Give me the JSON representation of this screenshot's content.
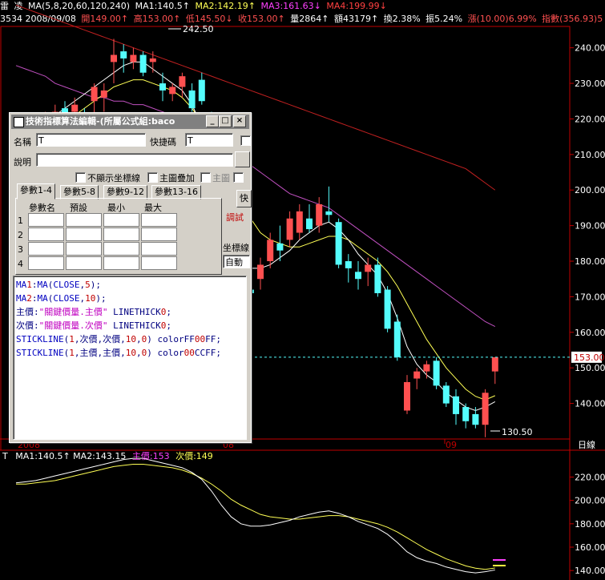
{
  "header": {
    "name_part1": "雷",
    "name_part2": "凌",
    "ma_params": "MA(5,8,20,60,120,240)",
    "ma1": "MA1:140.5↑",
    "ma2": "MA2:142.19↑",
    "ma3": "MA3:161.63↓",
    "ma4": "MA4:199.99↓",
    "code_date": "3534 2008/09/08",
    "open": "開149.00↑",
    "high": "高153.00↑",
    "low": "低145.50↓",
    "close": "收153.00↑",
    "volume": "量2864↑",
    "amount": "額43179↑",
    "turnover": "換2.38%",
    "amplitude": "振5.24%",
    "change": "漲(10.00)6.99%",
    "index": "指數(356.93)5"
  },
  "colors": {
    "background": "#000000",
    "up_candle": "#ff5050",
    "down_candle": "#54fcfc",
    "ma1": "#ffffff",
    "ma2": "#ffff55",
    "ma3": "#c050c0",
    "ma4": "#c02020",
    "frame": "#c00000",
    "accent_magenta": "#ff40ff",
    "accent_yellow": "#ffff40"
  },
  "price_axis": {
    "ticks": [
      "240.00",
      "230.00",
      "220.00",
      "210.00",
      "200.00",
      "190.00",
      "180.00",
      "170.00",
      "160.00",
      "150.00",
      "140.00"
    ],
    "current_price": "153.00",
    "high_marker": "242.50",
    "low_marker": "130.50"
  },
  "time_axis": {
    "labels": [
      "2008",
      "08",
      "09"
    ],
    "corner": "日線"
  },
  "indicator_panel": {
    "name": "T",
    "ma1": "MA1:140.5↑",
    "ma2": "MA2:143.15",
    "main_price": "主價:153",
    "sub_price": "次價:149",
    "ticks": [
      "220.00",
      "200.00",
      "180.00",
      "160.00",
      "140.00"
    ]
  },
  "dialog": {
    "title": "技術指標算法編輯-(所屬公式組:baco",
    "min_label": "_",
    "max_label": "□",
    "close_label": "×",
    "name_label": "名稱",
    "name_value": "T",
    "hotkey_label": "快捷碼",
    "hotkey_value": "T",
    "desc_label": "說明",
    "desc_value": "",
    "chk_no_axis": "不顯示坐標線",
    "chk_main_overlay": "主圖疊加",
    "chk_main_graph": "主圖",
    "tabs": [
      "參數1-4",
      "參數5-8",
      "參數9-12",
      "參數13-16"
    ],
    "param_headers": [
      "參數名",
      "預設",
      "最小",
      "最大"
    ],
    "row_labels": [
      "1",
      "2",
      "3",
      "4"
    ],
    "side_button": "快",
    "debug_label": "調試",
    "axis_label": "坐標線",
    "axis_value": "自動",
    "code_lines": [
      "MA1:MA(CLOSE,5);",
      "MA2:MA(CLOSE,10);",
      "主價:\"關鍵價量.主價\" LINETHICK0;",
      "次價:\"關鍵價量.次價\" LINETHICK0;",
      "STICKLINE(1,次價,次價,10,0) colorFF00FF;",
      "STICKLINE(1,主價,主價,10,0) color00CCFF;"
    ]
  },
  "chart_data": {
    "type": "candlestick",
    "ylim": [
      130,
      246
    ],
    "candles": [
      {
        "o": 215,
        "h": 218,
        "l": 212,
        "c": 213
      },
      {
        "o": 213,
        "h": 219,
        "l": 211,
        "c": 217
      },
      {
        "o": 214,
        "h": 218,
        "l": 212,
        "c": 216
      },
      {
        "o": 218,
        "h": 222,
        "l": 216,
        "c": 220
      },
      {
        "o": 219,
        "h": 224,
        "l": 217,
        "c": 222
      },
      {
        "o": 223,
        "h": 225,
        "l": 218,
        "c": 219
      },
      {
        "o": 222,
        "h": 226,
        "l": 220,
        "c": 224
      },
      {
        "o": 221,
        "h": 223,
        "l": 218,
        "c": 219
      },
      {
        "o": 225,
        "h": 230,
        "l": 220,
        "c": 229
      },
      {
        "o": 226,
        "h": 230,
        "l": 222,
        "c": 228
      },
      {
        "o": 236,
        "h": 242.5,
        "l": 230,
        "c": 238
      },
      {
        "o": 239,
        "h": 241,
        "l": 233,
        "c": 237
      },
      {
        "o": 236,
        "h": 240,
        "l": 234,
        "c": 238
      },
      {
        "o": 238,
        "h": 239,
        "l": 232,
        "c": 233
      },
      {
        "o": 236,
        "h": 239,
        "l": 233,
        "c": 237
      },
      {
        "o": 230,
        "h": 233,
        "l": 225,
        "c": 228
      },
      {
        "o": 227,
        "h": 230,
        "l": 225,
        "c": 229
      },
      {
        "o": 229,
        "h": 233,
        "l": 226,
        "c": 232
      },
      {
        "o": 228,
        "h": 230,
        "l": 222,
        "c": 223
      },
      {
        "o": 231,
        "h": 233,
        "l": 224,
        "c": 225
      },
      {
        "o": 220,
        "h": 222,
        "l": 210,
        "c": 212
      },
      {
        "o": 185,
        "h": 190,
        "l": 180,
        "c": 183
      },
      {
        "o": 176,
        "h": 180,
        "l": 165,
        "c": 168
      },
      {
        "o": 170,
        "h": 178,
        "l": 163,
        "c": 176
      },
      {
        "o": 172,
        "h": 180,
        "l": 168,
        "c": 171
      },
      {
        "o": 175,
        "h": 181,
        "l": 172,
        "c": 179
      },
      {
        "o": 180,
        "h": 188,
        "l": 178,
        "c": 186
      },
      {
        "o": 185,
        "h": 190,
        "l": 180,
        "c": 183
      },
      {
        "o": 186,
        "h": 194,
        "l": 184,
        "c": 192
      },
      {
        "o": 188,
        "h": 196,
        "l": 186,
        "c": 194
      },
      {
        "o": 192,
        "h": 196,
        "l": 188,
        "c": 189
      },
      {
        "o": 190,
        "h": 198,
        "l": 188,
        "c": 196
      },
      {
        "o": 194,
        "h": 201,
        "l": 191,
        "c": 193
      },
      {
        "o": 191,
        "h": 192,
        "l": 178,
        "c": 179
      },
      {
        "o": 180,
        "h": 182,
        "l": 174,
        "c": 178
      },
      {
        "o": 177,
        "h": 180,
        "l": 172,
        "c": 175
      },
      {
        "o": 177,
        "h": 181,
        "l": 173,
        "c": 179
      },
      {
        "o": 179,
        "h": 181,
        "l": 170,
        "c": 171
      },
      {
        "o": 172,
        "h": 173,
        "l": 160,
        "c": 161
      },
      {
        "o": 163,
        "h": 165,
        "l": 152,
        "c": 153
      },
      {
        "o": 138,
        "h": 148,
        "l": 137,
        "c": 146
      },
      {
        "o": 147,
        "h": 150,
        "l": 144,
        "c": 149
      },
      {
        "o": 149,
        "h": 152,
        "l": 147,
        "c": 151
      },
      {
        "o": 152,
        "h": 153,
        "l": 144,
        "c": 145
      },
      {
        "o": 145,
        "h": 146,
        "l": 139,
        "c": 140
      },
      {
        "o": 142,
        "h": 144,
        "l": 134,
        "c": 137
      },
      {
        "o": 139,
        "h": 140,
        "l": 133,
        "c": 135
      },
      {
        "o": 137,
        "h": 139,
        "l": 133,
        "c": 134
      },
      {
        "o": 134,
        "h": 144,
        "l": 130.5,
        "c": 143
      },
      {
        "o": 149,
        "h": 153,
        "l": 145.5,
        "c": 153
      }
    ],
    "ma1": [
      215,
      216,
      217,
      219,
      221,
      223,
      225,
      227,
      229,
      231,
      233,
      235,
      236,
      236,
      234,
      232,
      230,
      228,
      224,
      218,
      208,
      196,
      186,
      180,
      178,
      178,
      179,
      181,
      183,
      186,
      188,
      190,
      191,
      189,
      186,
      182,
      179,
      176,
      171,
      164,
      156,
      151,
      148,
      146,
      143,
      141,
      139,
      138,
      139,
      140.5
    ],
    "ma2": [
      214,
      214,
      215,
      216,
      217,
      219,
      221,
      223,
      225,
      227,
      229,
      230,
      231,
      231,
      230,
      229,
      228,
      226,
      223,
      219,
      214,
      208,
      201,
      196,
      192,
      188,
      186,
      185,
      184,
      184,
      185,
      186,
      187,
      187,
      186,
      184,
      182,
      180,
      177,
      173,
      168,
      163,
      158,
      154,
      150,
      147,
      144,
      142,
      141,
      142.19
    ],
    "ma3": [
      235,
      234,
      233,
      232,
      230,
      229,
      228,
      227,
      226,
      226,
      225,
      225,
      224,
      224,
      223,
      222,
      221,
      220,
      218,
      217,
      215,
      213,
      211,
      209,
      207,
      205,
      203,
      201,
      199,
      198,
      197,
      196,
      195,
      193,
      191,
      189,
      187,
      185,
      183,
      181,
      179,
      177,
      175,
      173,
      171,
      169,
      167,
      165,
      163,
      161.63
    ],
    "ma4": [
      252,
      251,
      250,
      249,
      248,
      247,
      246,
      245,
      244,
      243,
      242,
      241,
      240,
      239,
      238,
      237,
      236,
      235,
      234,
      233,
      232,
      231,
      230,
      229,
      228,
      227,
      226,
      225,
      224,
      223,
      222,
      221,
      220,
      219,
      218,
      217,
      216,
      215,
      214,
      213,
      212,
      211,
      210,
      209,
      208,
      207,
      206,
      204,
      202,
      199.99
    ]
  }
}
